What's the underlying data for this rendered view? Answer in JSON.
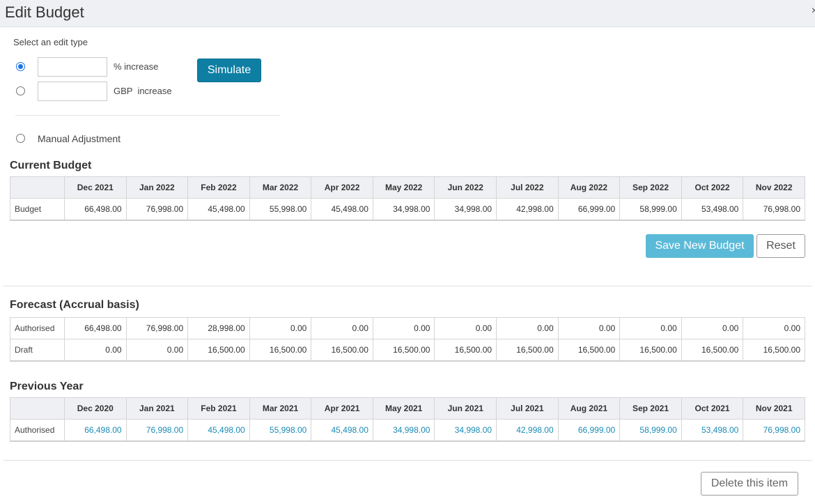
{
  "dialog": {
    "title": "Edit Budget",
    "close_glyph": "×"
  },
  "edit_type": {
    "label": "Select an edit type",
    "percent": {
      "value": "",
      "suffix": "% increase",
      "selected": true
    },
    "gbp": {
      "value": "",
      "suffix": "GBP  increase",
      "selected": false
    },
    "manual": {
      "label": "Manual Adjustment",
      "selected": false
    },
    "simulate_label": "Simulate"
  },
  "current_budget": {
    "title": "Current Budget",
    "columns": [
      "Dec 2021",
      "Jan 2022",
      "Feb 2022",
      "Mar 2022",
      "Apr 2022",
      "May 2022",
      "Jun 2022",
      "Jul 2022",
      "Aug 2022",
      "Sep 2022",
      "Oct 2022",
      "Nov 2022"
    ],
    "rows": [
      {
        "label": "Budget",
        "values": [
          "66,498.00",
          "76,998.00",
          "45,498.00",
          "55,998.00",
          "45,498.00",
          "34,998.00",
          "34,998.00",
          "42,998.00",
          "66,999.00",
          "58,999.00",
          "53,498.00",
          "76,998.00"
        ]
      }
    ]
  },
  "actions": {
    "save_label": "Save New Budget",
    "reset_label": "Reset"
  },
  "forecast": {
    "title": "Forecast (Accrual basis)",
    "rows": [
      {
        "label": "Authorised",
        "values": [
          "66,498.00",
          "76,998.00",
          "28,998.00",
          "0.00",
          "0.00",
          "0.00",
          "0.00",
          "0.00",
          "0.00",
          "0.00",
          "0.00",
          "0.00"
        ]
      },
      {
        "label": "Draft",
        "values": [
          "0.00",
          "0.00",
          "16,500.00",
          "16,500.00",
          "16,500.00",
          "16,500.00",
          "16,500.00",
          "16,500.00",
          "16,500.00",
          "16,500.00",
          "16,500.00",
          "16,500.00"
        ]
      }
    ]
  },
  "previous_year": {
    "title": "Previous Year",
    "columns": [
      "Dec 2020",
      "Jan 2021",
      "Feb 2021",
      "Mar 2021",
      "Apr 2021",
      "May 2021",
      "Jun 2021",
      "Jul 2021",
      "Aug 2021",
      "Sep 2021",
      "Oct 2021",
      "Nov 2021"
    ],
    "rows": [
      {
        "label": "Authorised",
        "values": [
          "66,498.00",
          "76,998.00",
          "45,498.00",
          "55,998.00",
          "45,498.00",
          "34,998.00",
          "34,998.00",
          "42,998.00",
          "66,999.00",
          "58,999.00",
          "53,498.00",
          "76,998.00"
        ]
      }
    ]
  },
  "footer": {
    "delete_label": "Delete this item"
  },
  "colors": {
    "primary": "#0e7fa3",
    "save": "#5bbad8",
    "link": "#1a8bb5",
    "header_bg": "#eef0f3"
  }
}
